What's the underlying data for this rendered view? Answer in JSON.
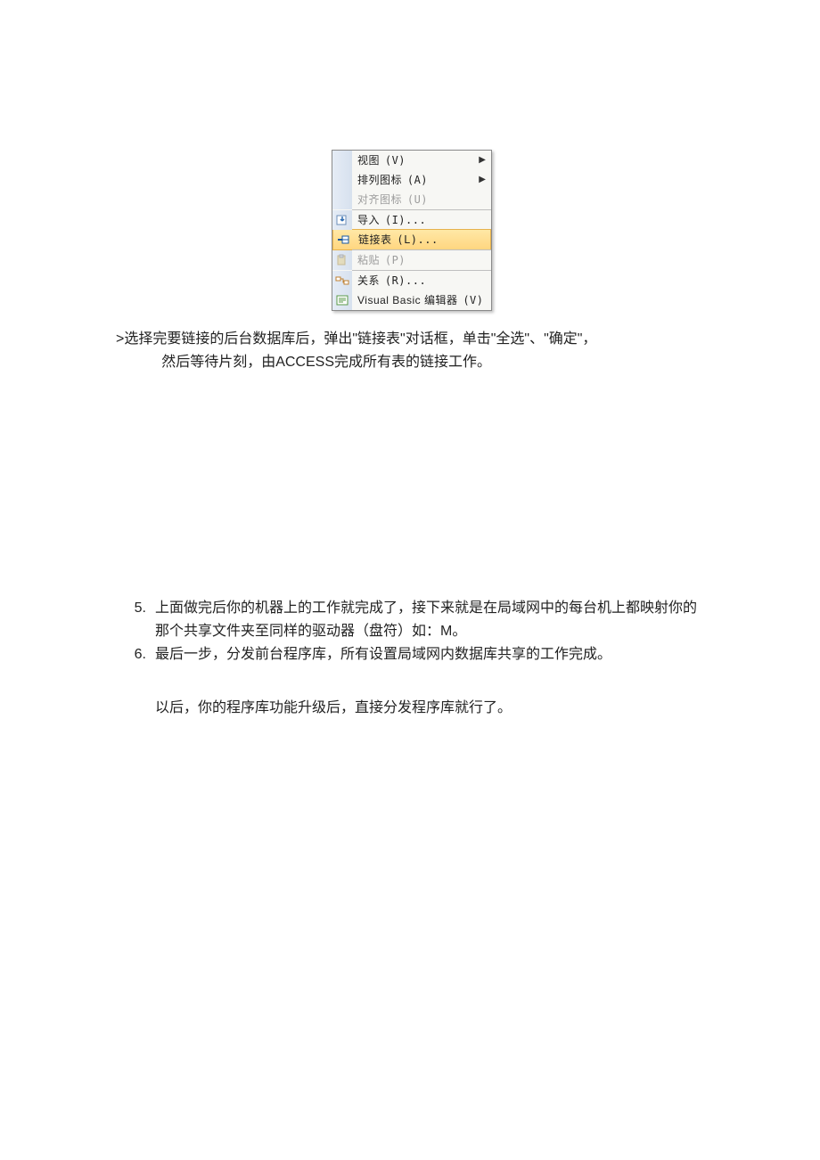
{
  "menu": {
    "items": [
      {
        "label": "视图",
        "hotkey": "(V)",
        "has_submenu": true,
        "enabled": true,
        "selected": false,
        "icon": null
      },
      {
        "label": "排列图标",
        "hotkey": "(A)",
        "has_submenu": true,
        "enabled": true,
        "selected": false,
        "icon": null
      },
      {
        "label": "对齐图标",
        "hotkey": "(U)",
        "has_submenu": false,
        "enabled": false,
        "selected": false,
        "icon": null
      },
      {
        "label": "导入",
        "hotkey": "(I)...",
        "has_submenu": false,
        "enabled": true,
        "selected": false,
        "icon": "import-icon"
      },
      {
        "label": "链接表",
        "hotkey": "(L)...",
        "has_submenu": false,
        "enabled": true,
        "selected": true,
        "icon": "link-table-icon"
      },
      {
        "label": "粘贴",
        "hotkey": "(P)",
        "has_submenu": false,
        "enabled": false,
        "selected": false,
        "icon": "paste-icon"
      },
      {
        "label": "关系",
        "hotkey": "(R)...",
        "has_submenu": false,
        "enabled": true,
        "selected": false,
        "icon": "relations-icon"
      },
      {
        "label": "Visual Basic 编辑器",
        "hotkey": "(V)",
        "has_submenu": false,
        "enabled": true,
        "selected": false,
        "icon": "vbe-icon"
      }
    ],
    "separators_after": [
      2,
      4,
      5
    ]
  },
  "paragraph1": {
    "line1": ">选择完要链接的后台数据库后，弹出\"链接表\"对话框，单击\"全选\"、\"确定\"，",
    "line2": "然后等待片刻，由ACCESS完成所有表的链接工作。"
  },
  "list": [
    {
      "num": "5.",
      "text": "上面做完后你的机器上的工作就完成了，接下来就是在局域网中的每台机上都映射你的那个共享文件夹至同样的驱动器（盘符）如：M。"
    },
    {
      "num": "6.",
      "text": "最后一步，分发前台程序库，所有设置局域网内数据库共享的工作完成。"
    }
  ],
  "tail": "以后，你的程序库功能升级后，直接分发程序库就行了。"
}
